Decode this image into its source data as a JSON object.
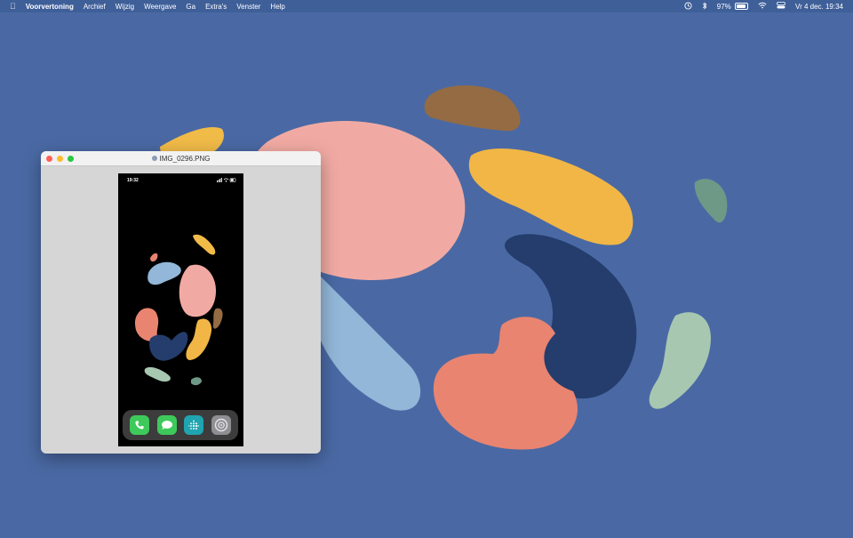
{
  "menubar": {
    "app_name": "Voorvertoning",
    "menus": [
      "Archief",
      "Wijzig",
      "Weergave",
      "Ga",
      "Extra's",
      "Venster",
      "Help"
    ],
    "battery": "97%",
    "battery_level": 0.97,
    "datetime": "Vr 4 dec.  19:34"
  },
  "window": {
    "title": "IMG_0296.PNG"
  },
  "phone": {
    "time": "19:32"
  }
}
